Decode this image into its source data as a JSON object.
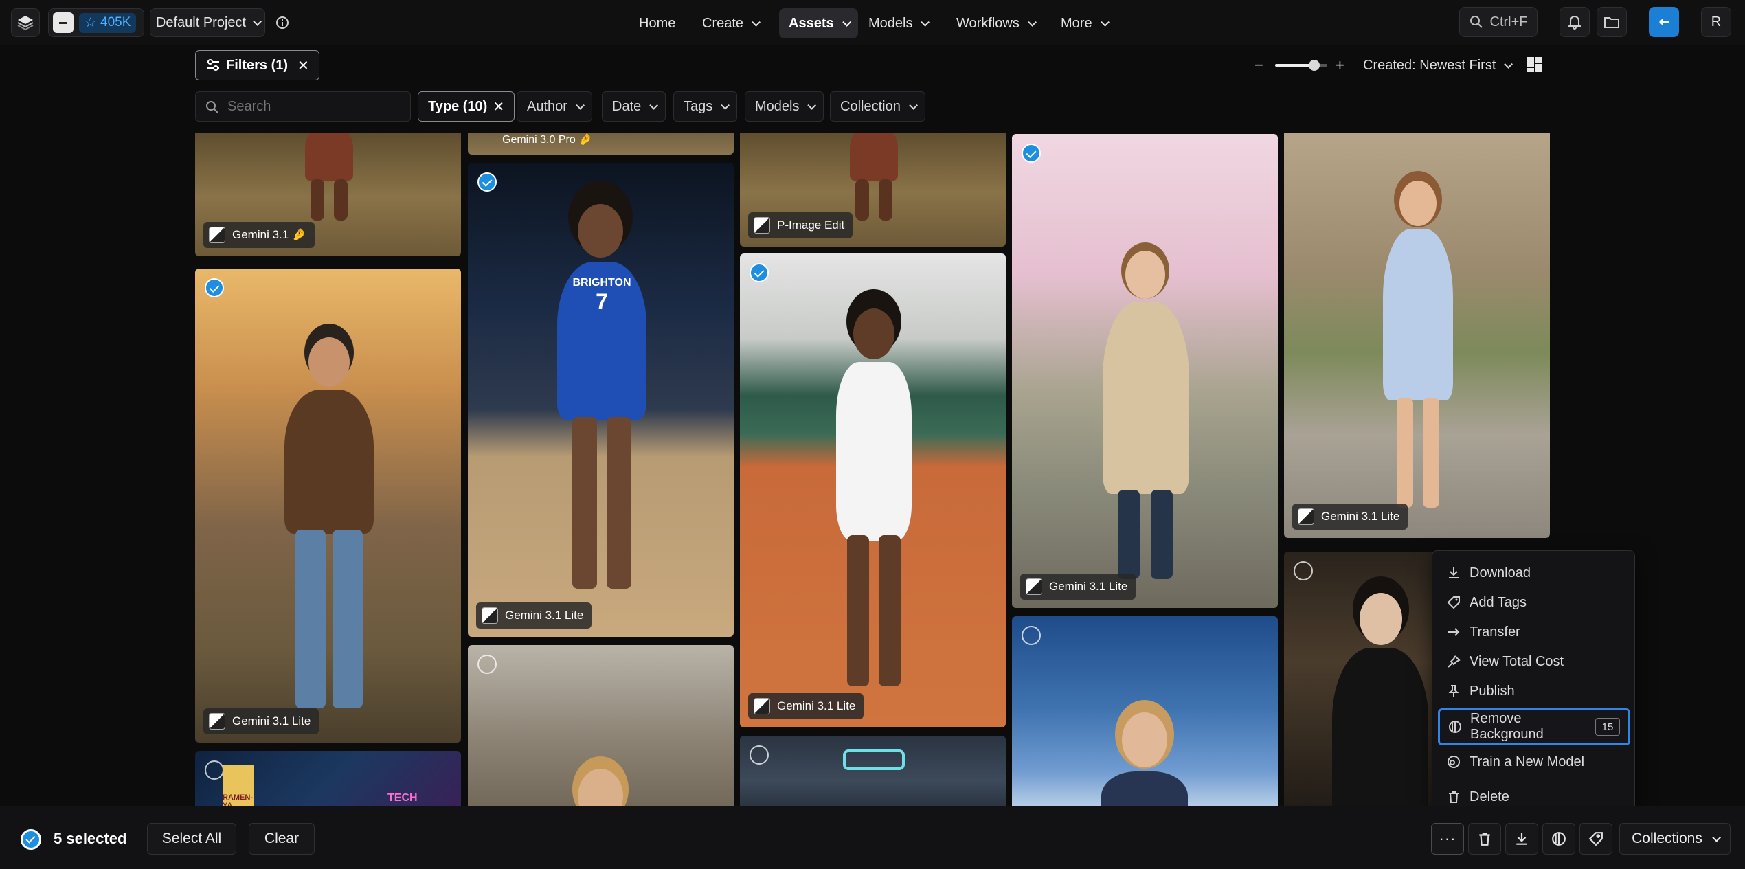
{
  "header": {
    "credits": "405K",
    "project": "Default Project",
    "nav": [
      {
        "label": "Home"
      },
      {
        "label": "Create"
      },
      {
        "label": "Assets"
      },
      {
        "label": "Models"
      },
      {
        "label": "Workflows"
      },
      {
        "label": "More"
      }
    ],
    "search_shortcut": "Ctrl+F",
    "avatar_initial": "R"
  },
  "toolbar": {
    "filters_label": "Filters (1)",
    "sort_label": "Created: Newest First",
    "search_placeholder": "Search",
    "type_label": "Type (10)",
    "author_label": "Author",
    "date_label": "Date",
    "tags_label": "Tags",
    "models_label": "Models",
    "collection_label": "Collection",
    "zoom_level": 0.75
  },
  "cards": {
    "c1": {
      "tag": "Gemini 3.1 🤌"
    },
    "c2": {
      "tag": "Gemini 3.0 Pro 🤌"
    },
    "c3": {
      "tag": "P-Image Edit"
    },
    "c4": {
      "tag": "Gemini 3.1 Lite"
    },
    "c5": {
      "tag": "Gemini 3.1 Lite"
    },
    "c6": {
      "tag": "Gemini 3.1 Lite"
    },
    "c7": {
      "tag": "Gemini 3.1 Lite"
    },
    "c8": {
      "tag": "Gemini 3.1 Lite"
    },
    "jersey_name": "BRIGHTON",
    "jersey_number": "7",
    "sign_text": "RAMEN-YA",
    "sign_text2": "TECH"
  },
  "context_menu": {
    "items": [
      {
        "label": "Download",
        "icon": "download-icon"
      },
      {
        "label": "Add Tags",
        "icon": "tag-icon"
      },
      {
        "label": "Transfer",
        "icon": "arrow-right-icon"
      },
      {
        "label": "View Total Cost",
        "icon": "pin-icon"
      },
      {
        "label": "Publish",
        "icon": "pushpin-icon"
      },
      {
        "label": "Remove Background",
        "icon": "remove-bg-icon",
        "badge": "15"
      },
      {
        "label": "Train a New Model",
        "icon": "train-icon"
      },
      {
        "label": "Delete",
        "icon": "trash-icon"
      }
    ]
  },
  "bottom_bar": {
    "selected_label": "5 selected",
    "select_all": "Select All",
    "clear": "Clear",
    "collections": "Collections"
  },
  "colors": {
    "accent": "#1e8fe0",
    "highlight_border": "#2f86e8",
    "background": "#0c0c0d"
  }
}
